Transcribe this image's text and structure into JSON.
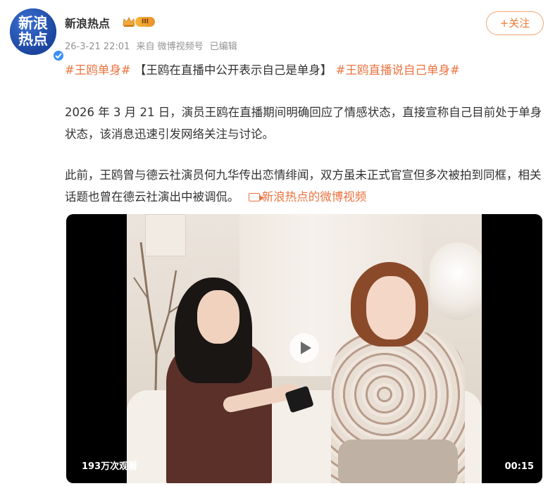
{
  "author": {
    "name": "新浪热点",
    "avatar_text": [
      "新浪",
      "热点"
    ],
    "level_badge": "III",
    "follow_label": "+关注"
  },
  "meta": {
    "time": "26-3-21 22:01",
    "source": "来自 微博视频号",
    "edited": "已编辑"
  },
  "post": {
    "tag1": "#王鸥单身#",
    "headline": "【王鸥在直播中公开表示自己是单身】",
    "tag2": "#王鸥直播说自己单身#",
    "paragraph1": "2026 年 3 月 21 日，演员王鸥在直播期间明确回应了情感状态，直接宣称自己目前处于单身状态，该消息迅速引发网络关注与讨论。",
    "paragraph2": "此前，王鸥曾与德云社演员何九华传出恋情绯闻，双方虽未正式官宣但多次被拍到同框，相关话题也曾在德云社演出中被调侃。",
    "video_link": "新浪热点的微博视频"
  },
  "video": {
    "views": "193万次观看",
    "duration": "00:15"
  },
  "colors": {
    "accent": "#eb7340",
    "meta_gray": "#939393",
    "avatar_blue": "#1f4fa8",
    "verified_blue": "#3a8ef6"
  },
  "icons": [
    "verified-icon",
    "crown-icon",
    "video-link-icon",
    "play-icon"
  ]
}
